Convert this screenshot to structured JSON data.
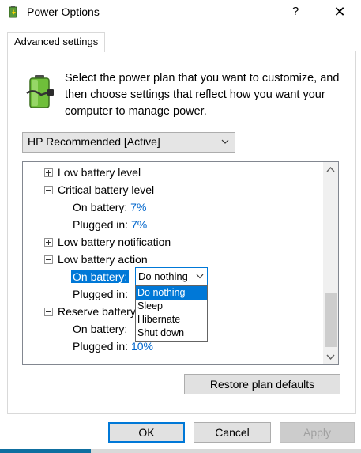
{
  "window": {
    "title": "Power Options",
    "help_glyph": "?",
    "close_glyph": "✕"
  },
  "tab": {
    "label": "Advanced settings"
  },
  "description": "Select the power plan that you want to customize, and then choose settings that reflect how you want your computer to manage power.",
  "plan_select": {
    "value": "HP Recommended [Active]"
  },
  "tree": {
    "low_battery_level": "Low battery level",
    "critical_battery_level": "Critical battery level",
    "crit_on_battery_label": "On battery:",
    "crit_on_battery_value": "7%",
    "crit_plugged_in_label": "Plugged in:",
    "crit_plugged_in_value": "7%",
    "low_battery_notification": "Low battery notification",
    "low_battery_action": "Low battery action",
    "action_on_battery_label": "On battery:",
    "action_plugged_in_label": "Plugged in:",
    "reserve_battery": "Reserve battery",
    "reserve_on_battery_label": "On battery:",
    "reserve_plugged_in_label": "Plugged in:",
    "reserve_plugged_in_value": "10%"
  },
  "combo": {
    "value": "Do nothing",
    "options": [
      "Do nothing",
      "Sleep",
      "Hibernate",
      "Shut down"
    ]
  },
  "buttons": {
    "restore": "Restore plan defaults",
    "ok": "OK",
    "cancel": "Cancel",
    "apply": "Apply"
  },
  "colors": {
    "accent": "#0078d7",
    "link": "#0066cc"
  }
}
